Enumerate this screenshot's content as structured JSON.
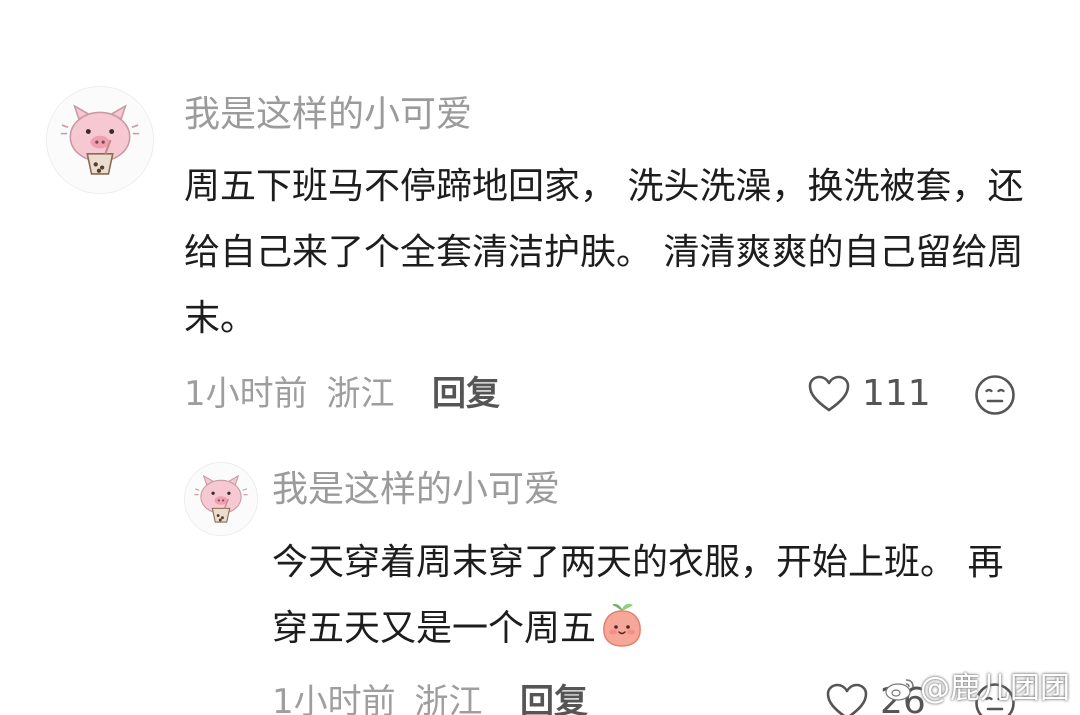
{
  "comments": [
    {
      "username": "我是这样的小可爱",
      "text": "周五下班马不停蹄地回家， 洗头洗澡，换洗被套，还给自己来了个全套清洁护肤。 清清爽爽的自己留给周末。",
      "time": "1小时前",
      "location": "浙江",
      "reply_label": "回复",
      "likes": "111",
      "avatar_icon": "pig-avatar-icon",
      "like_icon": "heart-outline-icon",
      "emoji_icon": "meh-face-icon"
    },
    {
      "username": "我是这样的小可爱",
      "text": "今天穿着周末穿了两天的衣服，开始上班。 再穿五天又是一个周五",
      "emoji": "peach-emoji",
      "time": "1小时前",
      "location": "浙江",
      "reply_label": "回复",
      "likes": "26",
      "avatar_icon": "pig-avatar-icon",
      "like_icon": "heart-outline-icon",
      "emoji_icon": "meh-face-icon"
    }
  ],
  "watermark": "@鹿儿团团",
  "colors": {
    "username": "#9b9b9b",
    "text": "#1d1d1d",
    "meta": "#9e9e9e",
    "action": "#555555",
    "avatar_pink": "#f6c9d2"
  }
}
